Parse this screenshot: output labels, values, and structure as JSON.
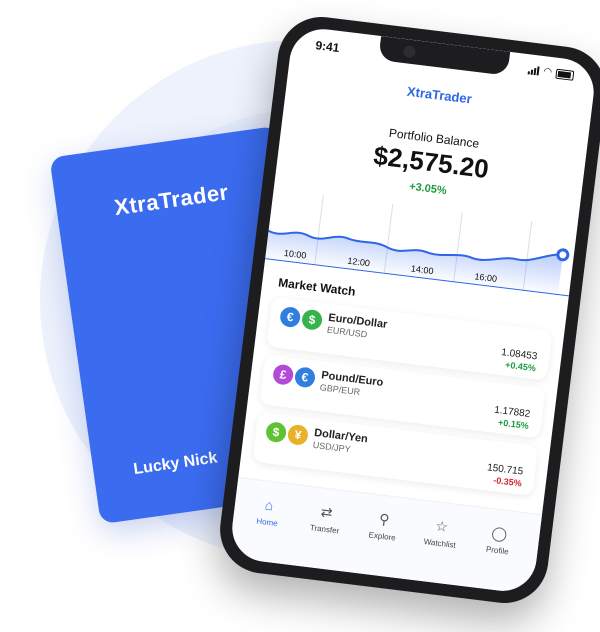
{
  "card": {
    "brand": "XtraTrader",
    "holder": "Lucky Nick"
  },
  "status": {
    "time": "9:41"
  },
  "app": {
    "title": "XtraTrader"
  },
  "portfolio": {
    "label": "Portfolio Balance",
    "value": "$2,575.20",
    "change": "+3.05%"
  },
  "chart": {
    "times": [
      "10:00",
      "12:00",
      "14:00",
      "16:00"
    ]
  },
  "market": {
    "title": "Market Watch",
    "rows": [
      {
        "name": "Euro/Dollar",
        "code": "EUR/USD",
        "price": "1.08453",
        "change": "+0.45%",
        "direction": "up",
        "coins": [
          {
            "symbol": "€",
            "color": "#2f7fe0"
          },
          {
            "symbol": "$",
            "color": "#36b34a"
          }
        ]
      },
      {
        "name": "Pound/Euro",
        "code": "GBP/EUR",
        "price": "1.17882",
        "change": "+0.15%",
        "direction": "up",
        "coins": [
          {
            "symbol": "£",
            "color": "#b34ad6"
          },
          {
            "symbol": "€",
            "color": "#2f7fe0"
          }
        ]
      },
      {
        "name": "Dollar/Yen",
        "code": "USD/JPY",
        "price": "150.715",
        "change": "-0.35%",
        "direction": "down",
        "coins": [
          {
            "symbol": "$",
            "color": "#5fc232"
          },
          {
            "symbol": "¥",
            "color": "#e8b12a"
          }
        ]
      }
    ]
  },
  "tabs": [
    {
      "label": "Home",
      "icon": "home-icon",
      "active": true
    },
    {
      "label": "Transfer",
      "icon": "transfer-icon",
      "active": false
    },
    {
      "label": "Explore",
      "icon": "explore-icon",
      "active": false
    },
    {
      "label": "Watchlist",
      "icon": "star-icon",
      "active": false
    },
    {
      "label": "Profile",
      "icon": "profile-icon",
      "active": false
    }
  ],
  "colors": {
    "brand": "#3b6cf0",
    "accent": "#2f66e8",
    "positive": "#1c9a3f",
    "negative": "#d4232f"
  }
}
